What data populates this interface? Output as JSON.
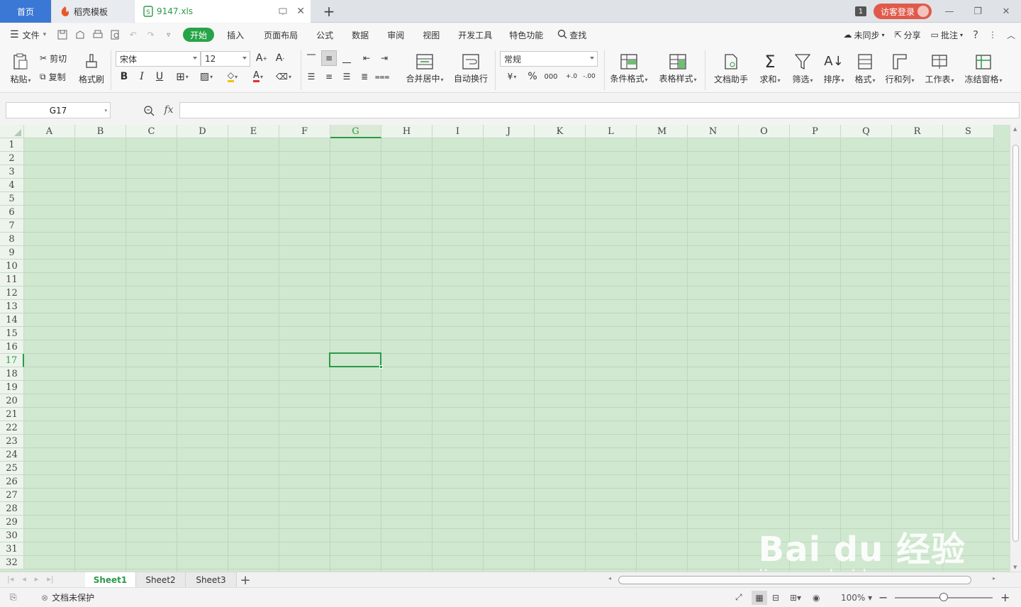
{
  "tabs": {
    "home": "首页",
    "template": "稻壳模板",
    "file": "9147.xls",
    "add": "+"
  },
  "topright": {
    "page_badge": "1",
    "login": "访客登录",
    "min": "—",
    "restore": "❐",
    "close": "✕"
  },
  "menu": {
    "file": "文件",
    "start": "开始",
    "items": [
      "插入",
      "页面布局",
      "公式",
      "数据",
      "审阅",
      "视图",
      "开发工具",
      "特色功能"
    ],
    "find": "查找",
    "sync": "未同步",
    "share": "分享",
    "comment": "批注",
    "help": "?"
  },
  "ribbon": {
    "paste": "粘贴",
    "cut": "剪切",
    "copy": "复制",
    "format_painter": "格式刷",
    "font_name": "宋体",
    "font_size": "12",
    "merge": "合并居中",
    "wrap": "自动换行",
    "number_format": "常规",
    "cond_format": "条件格式",
    "table_style": "表格样式",
    "doc_helper": "文档助手",
    "sum": "求和",
    "filter": "筛选",
    "sort": "排序",
    "format": "格式",
    "row_col": "行和列",
    "worksheet": "工作表",
    "freeze": "冻结窗格",
    "bold": "B",
    "italic": "I",
    "underline": "U"
  },
  "formula": {
    "name_box": "G17",
    "fx": "fx",
    "value": ""
  },
  "grid": {
    "columns": [
      "A",
      "B",
      "C",
      "D",
      "E",
      "F",
      "G",
      "H",
      "I",
      "J",
      "K",
      "L",
      "M",
      "N",
      "O",
      "P",
      "Q",
      "R",
      "S"
    ],
    "rows": [
      "1",
      "2",
      "3",
      "4",
      "5",
      "6",
      "7",
      "8",
      "9",
      "10",
      "11",
      "12",
      "13",
      "14",
      "15",
      "16",
      "17",
      "18",
      "19",
      "20",
      "21",
      "22",
      "23",
      "24",
      "25",
      "26",
      "27",
      "28",
      "29",
      "30",
      "31",
      "32"
    ],
    "active_col": "G",
    "active_row": "17"
  },
  "sheets": [
    "Sheet1",
    "Sheet2",
    "Sheet3"
  ],
  "status": {
    "protect": "文档未保护",
    "zoom": "100%"
  },
  "watermark": {
    "logo": "Bai du 经验",
    "url": "jingyan.baidu.com"
  },
  "colors": {
    "accent": "#2d9a4a",
    "grid_bg": "#cfe8cf",
    "home_tab": "#3b77d4",
    "login": "#e05a4b"
  }
}
